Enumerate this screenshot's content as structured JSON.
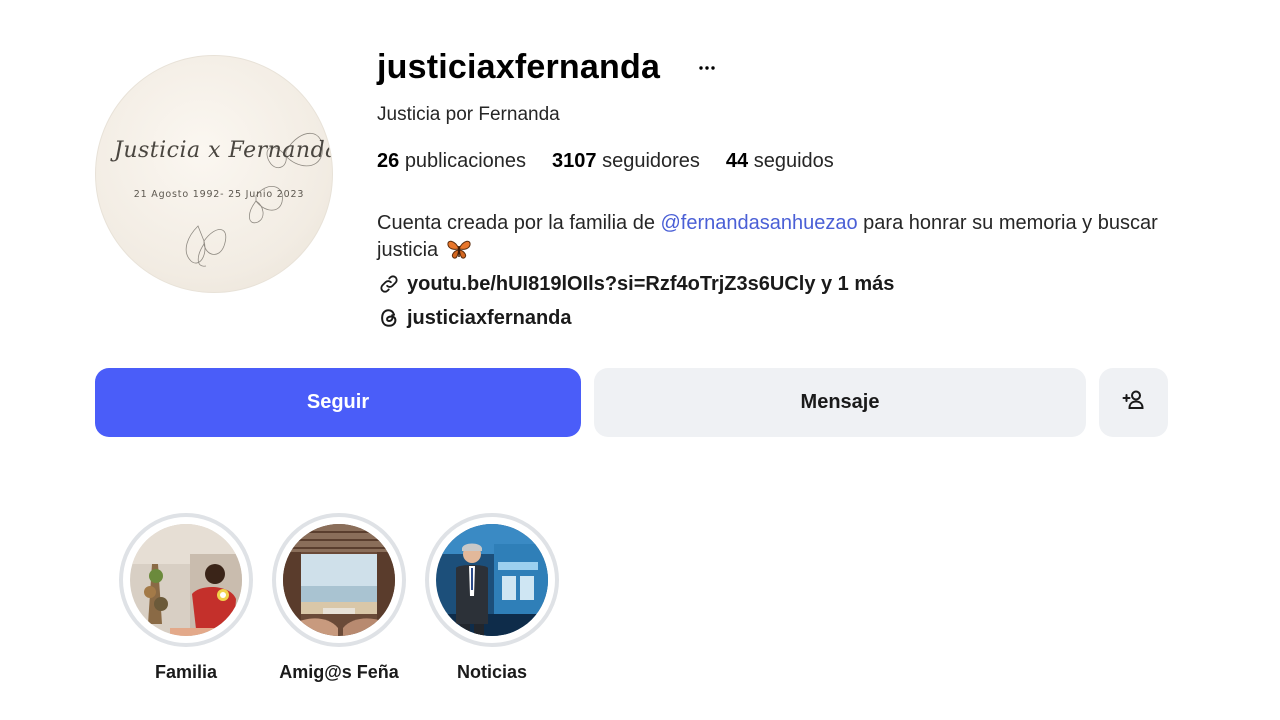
{
  "profile": {
    "username": "justiciaxfernanda",
    "more_icon": "ellipsis-icon",
    "full_name": "Justicia por Fernanda",
    "avatar": {
      "script_text": "Justicia x Fernanda",
      "dates_text": "21 Agosto 1992- 25 Junio 2023"
    }
  },
  "stats": {
    "posts_count": "26",
    "posts_label": "publicaciones",
    "followers_count": "3107",
    "followers_label": "seguidores",
    "following_count": "44",
    "following_label": "seguidos"
  },
  "bio": {
    "text_before": "Cuenta creada por la familia de ",
    "mention": "@fernandasanhuezao",
    "text_after": " para honrar su memoria y buscar justicia",
    "emoji_icon": "butterfly-icon"
  },
  "links": {
    "url_text": "youtu.be/hUI819lOIls?si=Rzf4oTrjZ3s6UCly y 1 más",
    "url_icon": "link-icon",
    "threads_text": "justiciaxfernanda",
    "threads_icon": "threads-icon"
  },
  "actions": {
    "follow_label": "Seguir",
    "message_label": "Mensaje",
    "add_user_icon": "add-user-icon"
  },
  "highlights": [
    {
      "label": "Familia"
    },
    {
      "label": "Amig@s Feña"
    },
    {
      "label": "Noticias"
    }
  ],
  "colors": {
    "accent": "#4a5df9",
    "mention": "#4a5fd6",
    "secondary_button": "#eff1f4",
    "highlight_ring": "#dfe2e6"
  }
}
